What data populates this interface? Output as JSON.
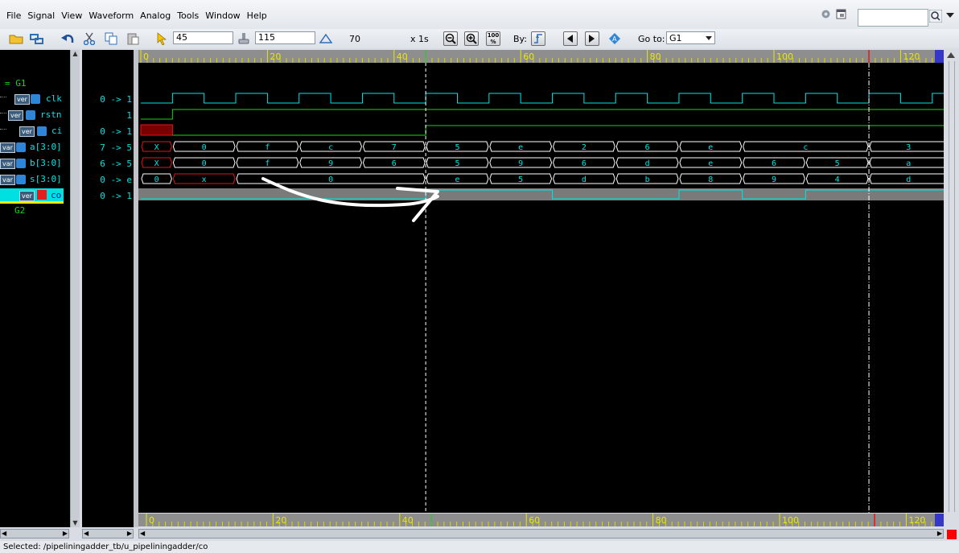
{
  "menu": {
    "items": [
      {
        "id": "file",
        "label": "File"
      },
      {
        "id": "signal",
        "label": "Signal"
      },
      {
        "id": "view",
        "label": "View"
      },
      {
        "id": "waveform",
        "label": "Waveform"
      },
      {
        "id": "analog",
        "label": "Analog"
      },
      {
        "id": "tools",
        "label": "Tools"
      },
      {
        "id": "window",
        "label": "Window"
      },
      {
        "id": "help",
        "label": "Help"
      }
    ]
  },
  "toolbar": {
    "cursor_time": "45",
    "marker_time": "115",
    "delta": "70",
    "scale": "x 1s",
    "zoom_fit_label": "100\n%",
    "by_label": "By:",
    "goto_label": "Go to:",
    "goto_value": "G1",
    "search_value": ""
  },
  "signals": {
    "group1": "G1",
    "group2": "G2",
    "rows": [
      {
        "name": "clk",
        "value": "0 -> 1",
        "badge": "ver"
      },
      {
        "name": "rstn",
        "value": "1",
        "badge": "ver"
      },
      {
        "name": "ci",
        "value": "0 -> 1",
        "badge": "ver"
      },
      {
        "name": "a[3:0]",
        "value": "7 -> 5",
        "badge": "var"
      },
      {
        "name": "b[3:0]",
        "value": "6 -> 5",
        "badge": "var"
      },
      {
        "name": "s[3:0]",
        "value": "0 -> e",
        "badge": "var"
      },
      {
        "name": "co",
        "value": "0 -> 1",
        "badge": "ver"
      }
    ]
  },
  "ruler": {
    "labels": [
      "0",
      "20",
      "40",
      "60",
      "80",
      "100",
      "120"
    ]
  },
  "waves": {
    "a": [
      {
        "t0": 0,
        "t1": 5,
        "v": "X"
      },
      {
        "t0": 5,
        "t1": 15,
        "v": "0"
      },
      {
        "t0": 15,
        "t1": 25,
        "v": "f"
      },
      {
        "t0": 25,
        "t1": 35,
        "v": "c"
      },
      {
        "t0": 35,
        "t1": 45,
        "v": "7"
      },
      {
        "t0": 45,
        "t1": 55,
        "v": "5"
      },
      {
        "t0": 55,
        "t1": 65,
        "v": "e"
      },
      {
        "t0": 65,
        "t1": 75,
        "v": "2"
      },
      {
        "t0": 75,
        "t1": 85,
        "v": "6"
      },
      {
        "t0": 85,
        "t1": 95,
        "v": "e"
      },
      {
        "t0": 95,
        "t1": 115,
        "v": "c"
      },
      {
        "t0": 115,
        "t1": 127.5,
        "v": "3"
      }
    ],
    "b": [
      {
        "t0": 0,
        "t1": 5,
        "v": "X"
      },
      {
        "t0": 5,
        "t1": 15,
        "v": "0"
      },
      {
        "t0": 15,
        "t1": 25,
        "v": "f"
      },
      {
        "t0": 25,
        "t1": 35,
        "v": "9"
      },
      {
        "t0": 35,
        "t1": 45,
        "v": "6"
      },
      {
        "t0": 45,
        "t1": 55,
        "v": "5"
      },
      {
        "t0": 55,
        "t1": 65,
        "v": "9"
      },
      {
        "t0": 65,
        "t1": 75,
        "v": "6"
      },
      {
        "t0": 75,
        "t1": 85,
        "v": "d"
      },
      {
        "t0": 85,
        "t1": 95,
        "v": "e"
      },
      {
        "t0": 95,
        "t1": 105,
        "v": "6"
      },
      {
        "t0": 105,
        "t1": 115,
        "v": "5"
      },
      {
        "t0": 115,
        "t1": 127.5,
        "v": "a"
      }
    ],
    "s": [
      {
        "t0": 0,
        "t1": 5,
        "v": "0"
      },
      {
        "t0": 5,
        "t1": 15,
        "v": "x",
        "red": true
      },
      {
        "t0": 15,
        "t1": 45,
        "v": "0"
      },
      {
        "t0": 45,
        "t1": 55,
        "v": "e"
      },
      {
        "t0": 55,
        "t1": 65,
        "v": "5"
      },
      {
        "t0": 65,
        "t1": 75,
        "v": "d"
      },
      {
        "t0": 75,
        "t1": 85,
        "v": "b"
      },
      {
        "t0": 85,
        "t1": 95,
        "v": "8"
      },
      {
        "t0": 95,
        "t1": 105,
        "v": "9"
      },
      {
        "t0": 105,
        "t1": 115,
        "v": "4"
      },
      {
        "t0": 115,
        "t1": 127.5,
        "v": "d"
      }
    ]
  },
  "colors": {
    "accent": "#00e5e5",
    "wave_green": "#18d418",
    "red": "#e01818",
    "ruler_text": "#e8e800"
  },
  "status": {
    "text": "Selected: /pipeliningadder_tb/u_pipeliningadder/co"
  }
}
